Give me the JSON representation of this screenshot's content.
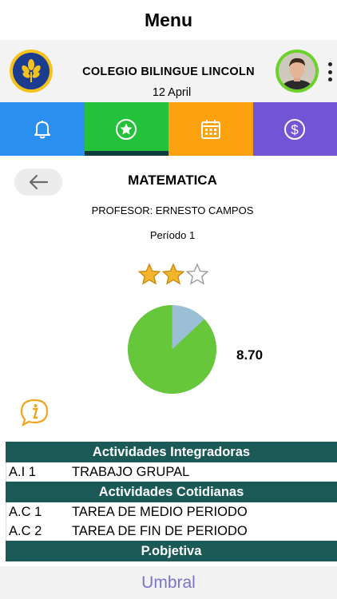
{
  "header": {
    "title": "Menu"
  },
  "school": {
    "name": "COLEGIO BILINGUE LINCOLN",
    "date": "12 April"
  },
  "tabs": [
    {
      "icon": "bell-icon",
      "color": "#2b8ff0"
    },
    {
      "icon": "star-circle-icon",
      "color": "#24c23b",
      "active": true
    },
    {
      "icon": "calendar-icon",
      "color": "#fca20e"
    },
    {
      "icon": "dollar-circle-icon",
      "color": "#7155d4"
    }
  ],
  "subject": {
    "title": "MATEMATICA",
    "teacher": "PROFESOR: ERNESTO CAMPOS",
    "period": "Período 1",
    "rating": {
      "filled": 2,
      "total": 3
    },
    "grade": "8.70",
    "pie": {
      "share": 0.87,
      "color": "#66c73a",
      "rest_color": "#9bbfd4"
    }
  },
  "table": {
    "sections": [
      {
        "title": "Actividades Integradoras",
        "rows": [
          {
            "code": "A.I 1",
            "name": "TRABAJO GRUPAL"
          }
        ]
      },
      {
        "title": "Actividades Cotidianas",
        "rows": [
          {
            "code": "A.C 1",
            "name": "TAREA DE MEDIO PERIODO"
          },
          {
            "code": "A.C 2",
            "name": "TAREA DE FIN DE PERIODO"
          }
        ]
      },
      {
        "title": "P.objetiva",
        "rows": []
      }
    ]
  },
  "footer": {
    "brand": "Umbral"
  }
}
